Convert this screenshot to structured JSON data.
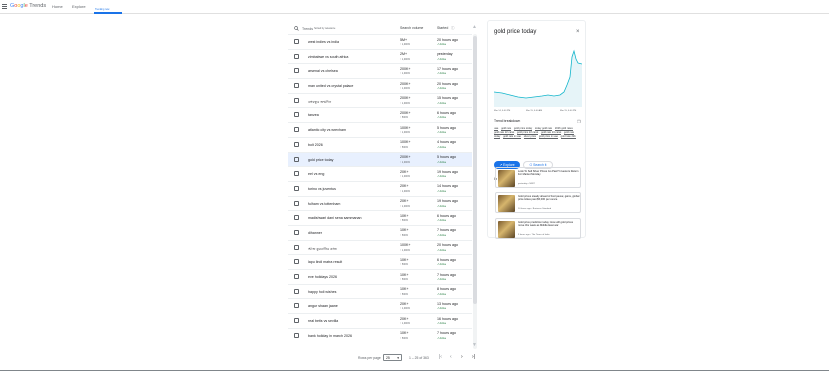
{
  "header": {
    "logo": {
      "g": "G",
      "o1": "o",
      "o2": "o",
      "g2": "g",
      "l": "l",
      "e": "e",
      "trends": " Trends"
    },
    "nav": [
      {
        "label": "Home"
      },
      {
        "label": "Explore"
      },
      {
        "label": "Trending now"
      }
    ]
  },
  "table": {
    "search_label": "Trends",
    "search_hint": "Sorted by relevance",
    "col_volume": "Search volume",
    "col_started": "Started",
    "rows": [
      {
        "name": "west indies vs india",
        "volume": "5M+",
        "pct": "↑ 1,000%",
        "started": "20 hours ago",
        "status": "Active"
      },
      {
        "name": "zimbabwe vs south africa",
        "volume": "2M+",
        "pct": "↑ 1,000%",
        "started": "yesterday",
        "status": "Active"
      },
      {
        "name": "arsenal vs chelsea",
        "volume": "200K+",
        "pct": "↑ 1,000%",
        "started": "17 hours ago",
        "status": "Active"
      },
      {
        "name": "man united vs crystal palace",
        "volume": "200K+",
        "pct": "↑ 1,000%",
        "started": "20 hours ago",
        "status": "Active"
      },
      {
        "name": "বঙ্গবন্ধুর জন্মদিন",
        "volume": "200K+",
        "pct": "↑ 1,000%",
        "started": "15 hours ago",
        "status": "Active"
      },
      {
        "name": "tanzea",
        "volume": "200K+",
        "pct": "↑ 500%",
        "started": "6 hours ago",
        "status": "Active"
      },
      {
        "name": "atlantic city vs wrexham",
        "volume": "100K+",
        "pct": "↑ 1,000%",
        "started": "5 hours ago",
        "status": "Active"
      },
      {
        "name": "bolt 2026",
        "volume": "100K+",
        "pct": "↑ 500%",
        "started": "4 hours ago",
        "status": "Active"
      },
      {
        "name": "gold price today",
        "volume": "200K+",
        "pct": "↑ 1,000%",
        "started": "5 hours ago",
        "status": "Active"
      },
      {
        "name": "eel vs eng",
        "volume": "20K+",
        "pct": "↑ 1,000%",
        "started": "19 hours ago",
        "status": "Active"
      },
      {
        "name": "torino vs juventus",
        "volume": "20K+",
        "pct": "↑ 1,000%",
        "started": "14 hours ago",
        "status": "Active"
      },
      {
        "name": "fulham vs tottenham",
        "volume": "20K+",
        "pct": "↑ 1,000%",
        "started": "19 hours ago",
        "status": "Active"
      },
      {
        "name": "madishwari dani sena sammanan",
        "volume": "10K+",
        "pct": "↑ 500%",
        "started": "6 hours ago",
        "status": "Active"
      },
      {
        "name": "dihanner",
        "volume": "10K+",
        "pct": "↑ 500%",
        "started": "7 hours ago",
        "status": "Active"
      },
      {
        "name": "আজ কুরবানির কাজ",
        "volume": "100K+",
        "pct": "↑ 1,000%",
        "started": "20 hours ago",
        "status": "Active"
      },
      {
        "name": "lapu lindi matra result",
        "volume": "10K+",
        "pct": "↑ 500%",
        "started": "6 hours ago",
        "status": "Active"
      },
      {
        "name": "eve holidays 2026",
        "volume": "10K+",
        "pct": "↑ 500%",
        "started": "7 hours ago",
        "status": "Active"
      },
      {
        "name": "happy holi wishes",
        "volume": "10K+",
        "pct": "↑ 500%",
        "started": "8 hours ago",
        "status": "Active"
      },
      {
        "name": "angur shaan jaane",
        "volume": "20K+",
        "pct": "↑ 1,000%",
        "started": "13 hours ago",
        "status": "Active"
      },
      {
        "name": "real betis vs sevilla",
        "volume": "20K+",
        "pct": "↑ 1,000%",
        "started": "16 hours ago",
        "status": "Active"
      },
      {
        "name": "bank holiday in march 2026",
        "volume": "10K+",
        "pct": "↑ 500%",
        "started": "7 hours ago",
        "status": "Active"
      }
    ],
    "pagination": {
      "rows_per_page_label": "Rows per page",
      "rows_per_page": "25",
      "range": "1 – 25 of 363"
    }
  },
  "detail": {
    "title": "gold price today",
    "chart_dates": [
      "Mar 14, 6:00 PM",
      "Mar 15, 6:00 AM",
      "Mar 15, 6:00 PM"
    ],
    "breakdown_label": "Trend breakdown",
    "breakdown_tags": [
      "uae",
      "gold rate",
      "gold price today",
      "today gold rate",
      "2026 gold rates",
      "gold rate 22 carat",
      "gold price 22 carat",
      "gold rate 24 carat",
      "gold rate today",
      "gold rate in uae",
      "silver price",
      "gold price in uae",
      "gold rate 22k"
    ],
    "explore_label": "Explore",
    "search_label": "Search it",
    "news_label": "In the news",
    "news": [
      {
        "headline": "Look To Sell Silver Prices Go Past? Investors Return For Market Monday",
        "source": "yesterday • MINT"
      },
      {
        "headline": "Gold prices steady ahead of Fed pause; gains, global price Hikes past $5,000 per ounce",
        "source": "10 hours ago • Business Standard"
      },
      {
        "headline": "Gold price prediction today: How will gold prices move this week as Middle East war",
        "source": "9 hours ago • The Times of India"
      }
    ]
  },
  "colors": {
    "accent": "#1a73e8",
    "active_status": "#137333",
    "selected_row": "#e8f0fe"
  }
}
